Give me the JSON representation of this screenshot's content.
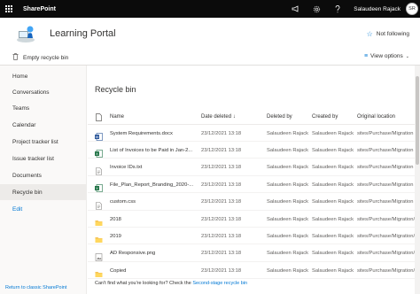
{
  "suite": {
    "app_name": "SharePoint",
    "user_name": "Salaudeen Rajack",
    "user_initials": "SR",
    "icons": [
      "waffle-icon",
      "megaphone-icon",
      "gear-icon",
      "help-icon"
    ]
  },
  "site": {
    "title": "Learning Portal",
    "follow_label": "Not following"
  },
  "commandbar": {
    "empty_recycle_bin": "Empty recycle bin",
    "view_options": "View options"
  },
  "nav": {
    "items": [
      {
        "label": "Home"
      },
      {
        "label": "Conversations"
      },
      {
        "label": "Teams"
      },
      {
        "label": "Calendar"
      },
      {
        "label": "Project tracker list"
      },
      {
        "label": "Issue tracker list"
      },
      {
        "label": "Documents"
      },
      {
        "label": "Recycle bin"
      },
      {
        "label": "Edit"
      }
    ],
    "return_classic": "Return to classic SharePoint"
  },
  "main": {
    "title": "Recycle bin",
    "columns": {
      "name": "Name",
      "date_deleted": "Date deleted ↓",
      "deleted_by": "Deleted by",
      "created_by": "Created by",
      "original_location": "Original location"
    },
    "rows": [
      {
        "name": "System Requirements.docx",
        "type": "word",
        "date": "23/12/2021 13:18",
        "deleted_by": "Salaudeen Rajack",
        "created_by": "Salaudeen Rajack",
        "location": "sites/Purchase/Migration"
      },
      {
        "name": "List of Invoices to be Paid in Jan-2...",
        "type": "excel",
        "date": "23/12/2021 13:18",
        "deleted_by": "Salaudeen Rajack",
        "created_by": "Salaudeen Rajack",
        "location": "sites/Purchase/Migration"
      },
      {
        "name": "Invoice IDs.txt",
        "type": "text",
        "date": "23/12/2021 13:18",
        "deleted_by": "Salaudeen Rajack",
        "created_by": "Salaudeen Rajack",
        "location": "sites/Purchase/Migration"
      },
      {
        "name": "File_Plan_Report_Branding_2020-...",
        "type": "excel",
        "date": "23/12/2021 13:18",
        "deleted_by": "Salaudeen Rajack",
        "created_by": "Salaudeen Rajack",
        "location": "sites/Purchase/Migration"
      },
      {
        "name": "custom.css",
        "type": "text",
        "date": "23/12/2021 13:18",
        "deleted_by": "Salaudeen Rajack",
        "created_by": "Salaudeen Rajack",
        "location": "sites/Purchase/Migration"
      },
      {
        "name": "2018",
        "type": "folder",
        "date": "23/12/2021 13:18",
        "deleted_by": "Salaudeen Rajack",
        "created_by": "Salaudeen Rajack",
        "location": "sites/Purchase/Migration/N"
      },
      {
        "name": "2019",
        "type": "folder",
        "date": "23/12/2021 13:18",
        "deleted_by": "Salaudeen Rajack",
        "created_by": "Salaudeen Rajack",
        "location": "sites/Purchase/Migration/N"
      },
      {
        "name": "AD Responsive.png",
        "type": "image",
        "date": "23/12/2021 13:18",
        "deleted_by": "Salaudeen Rajack",
        "created_by": "Salaudeen Rajack",
        "location": "sites/Purchase/Migration/N"
      },
      {
        "name": "Copied",
        "type": "folder",
        "date": "23/12/2021 13:18",
        "deleted_by": "Salaudeen Rajack",
        "created_by": "Salaudeen Rajack",
        "location": "sites/Purchase/Migration/N"
      }
    ],
    "footer_text": "Can't find what you're looking for? Check the",
    "footer_link": "Second-stage recycle bin"
  },
  "colors": {
    "accent": "#0078d4",
    "suite_bg": "#0b0b0b",
    "nav_bg": "#faf9f8",
    "word": "#2b579a",
    "excel": "#217346",
    "folder": "#f4c254"
  }
}
